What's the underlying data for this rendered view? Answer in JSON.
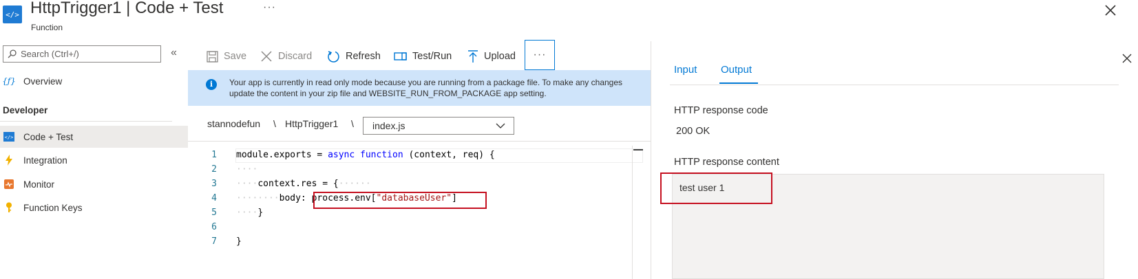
{
  "header": {
    "title": "HttpTrigger1 | Code + Test",
    "subtitle": "Function",
    "more": "···"
  },
  "sidebar": {
    "search_placeholder": "Search (Ctrl+/)",
    "collapse": "«",
    "overview": "Overview",
    "section_developer": "Developer",
    "items": [
      {
        "label": "Code + Test",
        "icon": "code-icon",
        "selected": true
      },
      {
        "label": "Integration",
        "icon": "lightning-icon"
      },
      {
        "label": "Monitor",
        "icon": "monitor-icon"
      },
      {
        "label": "Function Keys",
        "icon": "key-icon"
      }
    ]
  },
  "toolbar": {
    "save": "Save",
    "discard": "Discard",
    "refresh": "Refresh",
    "test_run": "Test/Run",
    "upload": "Upload",
    "more": "···"
  },
  "banner": {
    "icon": "i",
    "text": "Your app is currently in read only mode because you are running from a package file. To make any changes update the content in your zip file and WEBSITE_RUN_FROM_PACKAGE app setting."
  },
  "breadcrumb": {
    "app": "stannodefun",
    "sep": "\\",
    "function": "HttpTrigger1",
    "file": "index.js"
  },
  "code": {
    "line_numbers": [
      "1",
      "2",
      "3",
      "4",
      "5",
      "6",
      "7"
    ],
    "line1_a": "module.exports = ",
    "line1_kw1": "async",
    "line1_kw2": "function",
    "line1_b": " (context, req) {",
    "line3": "context.res = {",
    "line4_a": "body: ",
    "line4_b": "process.env[",
    "line4_str": "\"databaseUser\"",
    "line4_c": "]",
    "line5": "}",
    "line7": "}"
  },
  "panel": {
    "tab_input": "Input",
    "tab_output": "Output",
    "active_tab": "Output",
    "response_code_label": "HTTP response code",
    "response_code_value": "200 OK",
    "response_content_label": "HTTP response content",
    "response_content_value": "test user 1"
  },
  "colors": {
    "accent": "#0078d4",
    "banner": "#cfe4fa",
    "highlight": "#c50f1f"
  }
}
